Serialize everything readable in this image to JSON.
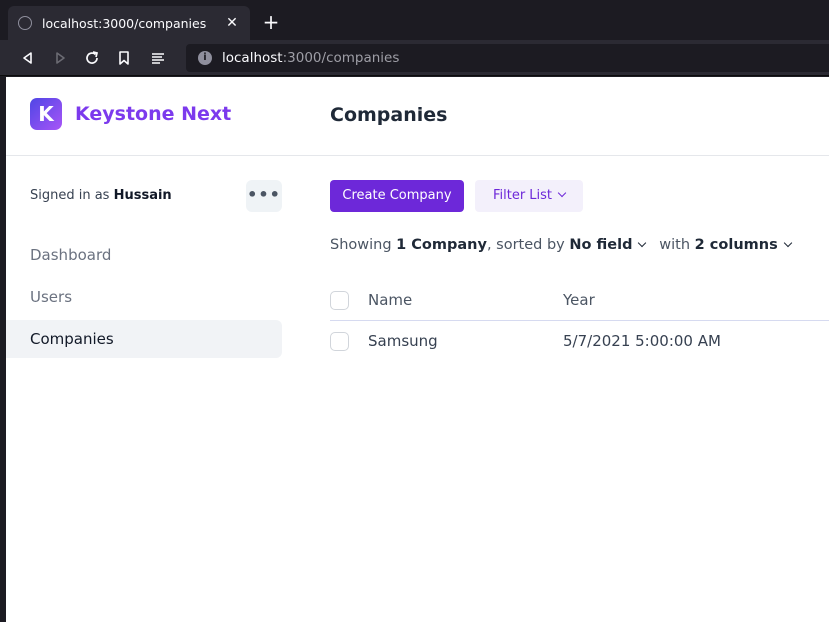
{
  "browser": {
    "tab_title": "localhost:3000/companies",
    "url_host": "localhost",
    "url_path": ":3000/companies"
  },
  "app": {
    "logo_letter": "K",
    "brand_name": "Keystone Next",
    "signed_in_prefix": "Signed in as ",
    "user_name": "Hussain",
    "more_label": "•••"
  },
  "sidebar": {
    "items": [
      {
        "label": "Dashboard",
        "active": false
      },
      {
        "label": "Users",
        "active": false
      },
      {
        "label": "Companies",
        "active": true
      }
    ]
  },
  "main": {
    "title": "Companies",
    "create_button": "Create Company",
    "filter_button": "Filter List",
    "summary": {
      "showing": "Showing ",
      "count": "1 Company",
      "sorted_by": ", sorted by ",
      "sort_field": "No field",
      "with": "with ",
      "columns": "2 columns"
    },
    "table": {
      "columns": [
        "Name",
        "Year"
      ],
      "rows": [
        {
          "name": "Samsung",
          "year": "5/7/2021 5:00:00 AM"
        }
      ]
    }
  },
  "colors": {
    "accent": "#6d28d9",
    "brand": "#7c3aed"
  }
}
